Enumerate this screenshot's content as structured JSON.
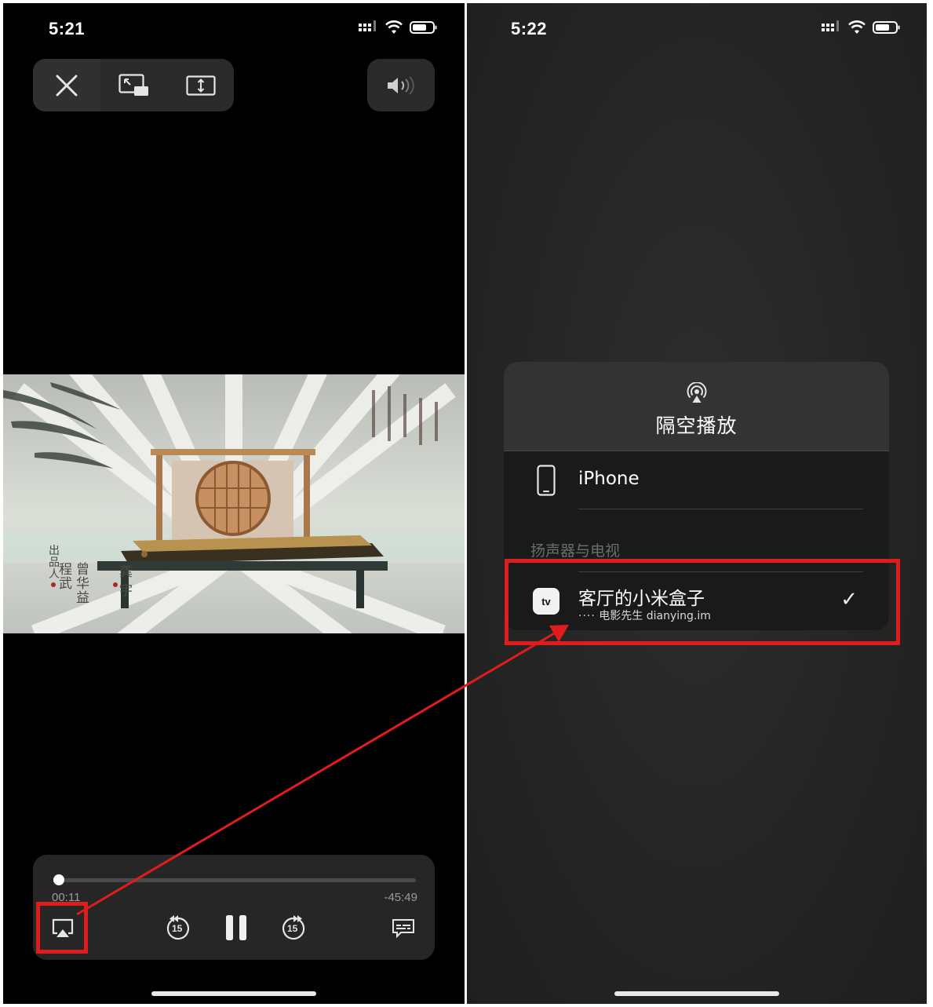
{
  "left": {
    "status_time": "5:21",
    "top_controls": {
      "close": "close-icon",
      "pip": "picture-in-picture-icon",
      "aspect": "aspect-fill-icon",
      "volume": "speaker-icon"
    },
    "playback": {
      "elapsed": "00:11",
      "remaining": "-45:49",
      "progress": 0.004,
      "skip_back_label": "15",
      "skip_forward_label": "15"
    },
    "video_text": {
      "credit_left_1": "出品人",
      "credit_left_2": "曾华益",
      "credit_left_3": "程武",
      "credit_right": "龚宇"
    }
  },
  "right": {
    "status_time": "5:22",
    "airplay": {
      "title": "隔空播放",
      "iphone_label": "iPhone",
      "section_label": "扬声器与电视",
      "tv_name": "客厅的小米盒子",
      "tv_badge": "tv",
      "tv_subtitle": "电影先生 dianying.im",
      "selected_mark": "✓"
    }
  },
  "colors": {
    "annotation": "#e01c1c",
    "panel_bg": "#1a1a1a",
    "panel_header_bg": "#333333",
    "controls_bg": "#262626"
  }
}
